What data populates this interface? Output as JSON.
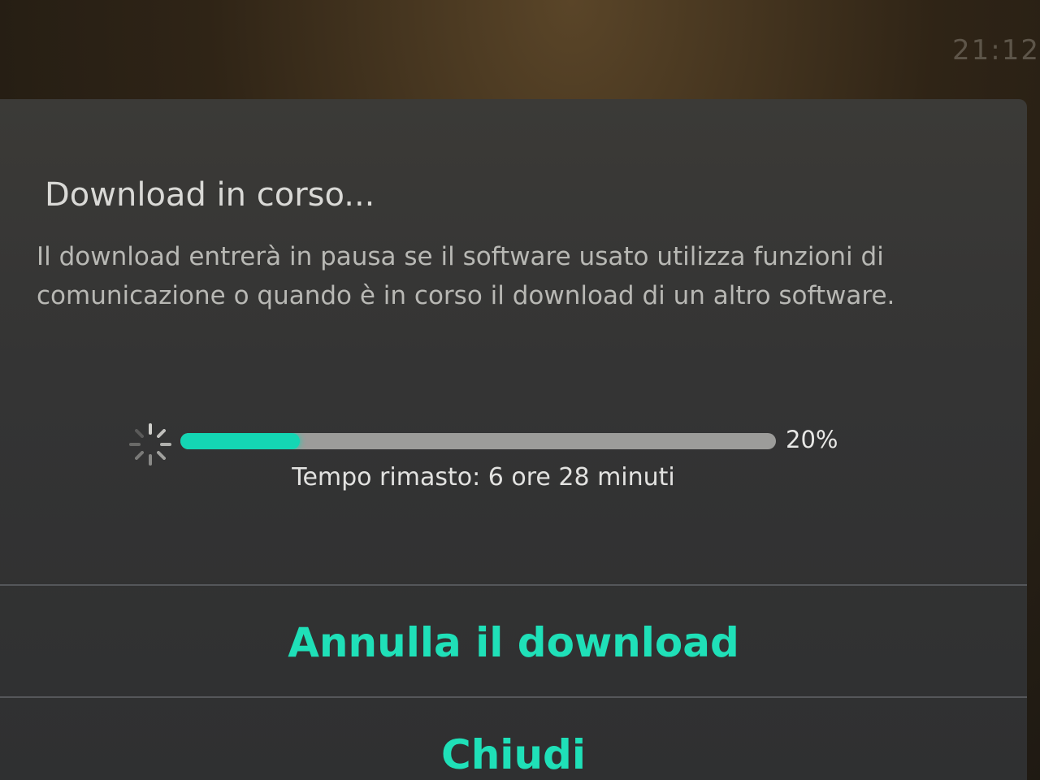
{
  "status_bar": {
    "time": "21:12"
  },
  "dialog": {
    "title": "Download in corso...",
    "description": "Il download entrerà in pausa se il software usato utilizza funzioni di comunicazione o quando è in corso il download di un altro software.",
    "progress": {
      "percent_value": 20,
      "percent_label": "20%",
      "time_remaining": "Tempo rimasto: 6 ore 28 minuti"
    },
    "buttons": {
      "cancel_download": "Annulla il download",
      "close": "Chiudi"
    }
  },
  "colors": {
    "accent": "#1fe0b8",
    "progress_fill": "#14d6b4",
    "dialog_background": "#343434"
  },
  "icons": {
    "spinner": "loading-spinner-icon"
  }
}
